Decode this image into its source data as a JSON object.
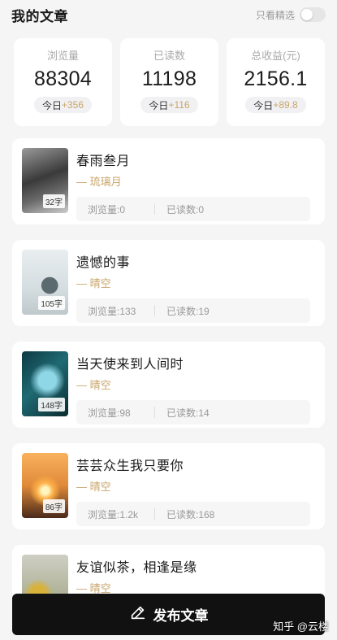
{
  "header": {
    "title": "我的文章",
    "filter_label": "只看精选"
  },
  "stats": [
    {
      "label": "浏览量",
      "value": "88304",
      "today_label": "今日",
      "today_inc": "+356"
    },
    {
      "label": "已读数",
      "value": "11198",
      "today_label": "今日",
      "today_inc": "+116"
    },
    {
      "label": "总收益(元)",
      "value": "2156.1",
      "today_label": "今日",
      "today_inc": "+89.8"
    }
  ],
  "articles": [
    {
      "title": "春雨叁月",
      "author": "— 琉璃月",
      "word_count": "32字",
      "views": "浏览量:0",
      "reads": "已读数:0"
    },
    {
      "title": "遗憾的事",
      "author": "— 晴空",
      "word_count": "105字",
      "views": "浏览量:133",
      "reads": "已读数:19"
    },
    {
      "title": "当天使来到人间时",
      "author": "— 晴空",
      "word_count": "148字",
      "views": "浏览量:98",
      "reads": "已读数:14"
    },
    {
      "title": "芸芸众生我只要你",
      "author": "— 晴空",
      "word_count": "86字",
      "views": "浏览量:1.2k",
      "reads": "已读数:168"
    },
    {
      "title": "友谊似茶，相逢是缘",
      "author": "— 晴空",
      "word_count": "",
      "views": "",
      "reads": ""
    }
  ],
  "publish_button": {
    "label": "发布文章",
    "icon": "pencil-icon"
  },
  "watermark": "知乎 @云楼"
}
